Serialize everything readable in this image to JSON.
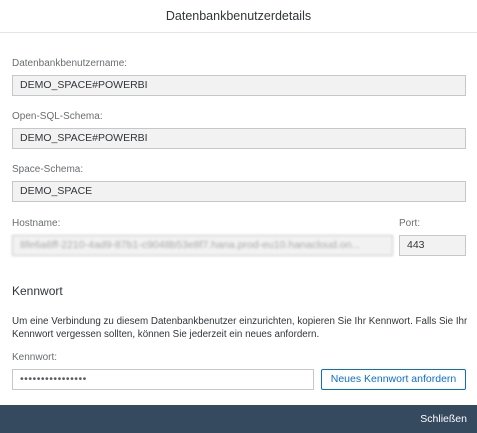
{
  "dialog": {
    "title": "Datenbankbenutzerdetails"
  },
  "fields": {
    "db_user": {
      "label": "Datenbankbenutzername:",
      "value": "DEMO_SPACE#POWERBI"
    },
    "open_sql_schema": {
      "label": "Open-SQL-Schema:",
      "value": "DEMO_SPACE#POWERBI"
    },
    "space_schema": {
      "label": "Space-Schema:",
      "value": "DEMO_SPACE"
    },
    "hostname": {
      "label": "Hostname:",
      "value": "8fe6a6ff-2210-4ad9-87b1-c9048b53e8f7.hana.prod-eu10.hanacloud.on...",
      "note": "blurred"
    },
    "port": {
      "label": "Port:",
      "value": "443"
    }
  },
  "password": {
    "section_title": "Kennwort",
    "description": "Um eine Verbindung zu diesem Datenbankbenutzer einzurichten, kopieren Sie Ihr Kennwort. Falls Sie Ihr Kennwort vergessen sollten, können Sie jederzeit ein neues anfordern.",
    "label": "Kennwort:",
    "masked_value": "••••••••••••••••",
    "request_new_label": "Neues Kennwort anfordern"
  },
  "footer": {
    "close_label": "Schließen"
  },
  "colors": {
    "accent": "#0a6ed1",
    "footer_bg": "#354a5f"
  }
}
